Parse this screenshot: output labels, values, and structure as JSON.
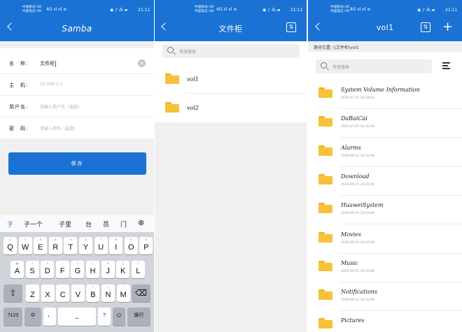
{
  "status": {
    "carrier_line1": "中国移动 HD",
    "carrier_line2": "中国电信 HD",
    "signal": "4G ııl ııl ≋",
    "icons": "◉ ♪ ⁂ ▰",
    "time": "21:11"
  },
  "samba_form": {
    "title": "Samba",
    "fields": [
      {
        "label": "名　称:",
        "value": "文件柜",
        "placeholder": ""
      },
      {
        "label": "主　机:",
        "value": "",
        "placeholder": "10.168.1.1"
      },
      {
        "label": "用户名:",
        "value": "",
        "placeholder": "请输入用户名（选填）"
      },
      {
        "label": "密　码:",
        "value": "",
        "placeholder": "请输入密码（选填）"
      }
    ],
    "save_label": "保存"
  },
  "keyboard": {
    "candidates": [
      "子",
      "子一个",
      "子里",
      "台",
      "员",
      "门"
    ],
    "row1": [
      [
        "1",
        "Q"
      ],
      [
        "2",
        "W"
      ],
      [
        "3",
        "E"
      ],
      [
        "4",
        "R"
      ],
      [
        "5",
        "T"
      ],
      [
        "6",
        "Y"
      ],
      [
        "7",
        "U"
      ],
      [
        "8",
        "I"
      ],
      [
        "9",
        "O"
      ],
      [
        "0",
        "P"
      ]
    ],
    "row2": [
      [
        "@",
        "A"
      ],
      [
        "*",
        "S"
      ],
      [
        "+",
        "D"
      ],
      [
        "-",
        "F"
      ],
      [
        "=",
        "G"
      ],
      [
        "/",
        "H"
      ],
      [
        "#",
        "J"
      ],
      [
        "(",
        "K"
      ],
      [
        ")",
        "L"
      ]
    ],
    "row3": [
      [
        "'",
        "Z"
      ],
      [
        "\"",
        "X"
      ],
      [
        ":",
        "C"
      ],
      [
        ";",
        "V"
      ],
      [
        "!",
        "B"
      ],
      [
        "?",
        "N"
      ],
      [
        "~",
        "M"
      ]
    ],
    "key_123": "?123",
    "key_lang": "中",
    "key_comma": "，",
    "key_question": "?",
    "key_enter": "换行"
  },
  "share_view": {
    "title": "文件柜",
    "search_placeholder": "快速搜索",
    "folders": [
      {
        "name": "vol1"
      },
      {
        "name": "vol2"
      }
    ]
  },
  "vol_view": {
    "title": "vol1",
    "path": "路径位置: \\\\文件柜\\vol1",
    "search_placeholder": "快速搜索",
    "folders": [
      {
        "name": "System Volume Information",
        "date": "2020-07-11 16:28:43"
      },
      {
        "name": "DaBaiCai",
        "date": "2020-07-07 10:30:49"
      },
      {
        "name": "Alarms",
        "date": "2020-09-25 14:20:06"
      },
      {
        "name": "Download",
        "date": "2020-09-25 14:20:06"
      },
      {
        "name": "HuaweiSystem",
        "date": "2020-09-25 14:20:06"
      },
      {
        "name": "Movies",
        "date": "2020-09-25 14:20:06"
      },
      {
        "name": "Music",
        "date": "2020-09-25 14:20:06"
      },
      {
        "name": "Notifications",
        "date": "2020-09-25 14:20:06"
      },
      {
        "name": "Pictures",
        "date": ""
      }
    ]
  },
  "colors": {
    "accent": "#1a73d4",
    "folder": "#f8c13a",
    "background_gray": "#f0f0f0"
  }
}
